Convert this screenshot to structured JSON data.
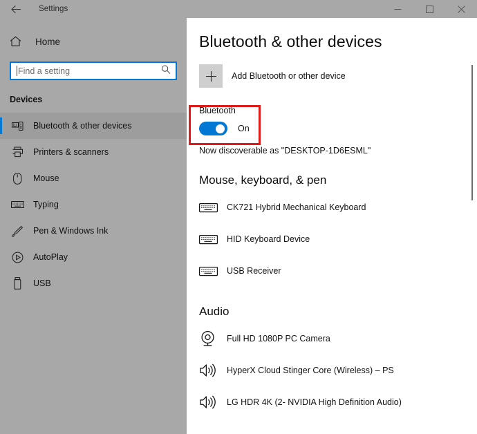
{
  "titlebar": {
    "back_icon": "back-arrow-icon",
    "title": "Settings",
    "minimize_label": "—",
    "maximize_label": "□",
    "close_label": "✕"
  },
  "sidebar": {
    "home_label": "Home",
    "home_icon": "home-icon",
    "search": {
      "placeholder": "Find a setting",
      "value": "",
      "icon": "search-icon"
    },
    "section_label": "Devices",
    "items": [
      {
        "label": "Bluetooth & other devices",
        "icon": "bluetooth-devices-icon",
        "selected": true
      },
      {
        "label": "Printers & scanners",
        "icon": "printer-icon",
        "selected": false
      },
      {
        "label": "Mouse",
        "icon": "mouse-icon",
        "selected": false
      },
      {
        "label": "Typing",
        "icon": "keyboard-icon",
        "selected": false
      },
      {
        "label": "Pen & Windows Ink",
        "icon": "pen-icon",
        "selected": false
      },
      {
        "label": "AutoPlay",
        "icon": "autoplay-icon",
        "selected": false
      },
      {
        "label": "USB",
        "icon": "usb-icon",
        "selected": false
      }
    ]
  },
  "main": {
    "page_title": "Bluetooth & other devices",
    "add_device": {
      "label": "Add Bluetooth or other device",
      "icon": "plus-icon"
    },
    "bluetooth": {
      "label": "Bluetooth",
      "state": "On",
      "toggle_on": true,
      "discoverable_text": "Now discoverable as \"DESKTOP-1D6ESML\""
    },
    "groups": [
      {
        "heading": "Mouse, keyboard, & pen",
        "devices": [
          {
            "label": "CK721 Hybrid Mechanical Keyboard",
            "icon": "keyboard-icon"
          },
          {
            "label": "HID Keyboard Device",
            "icon": "keyboard-icon"
          },
          {
            "label": "USB Receiver",
            "icon": "keyboard-icon"
          }
        ]
      },
      {
        "heading": "Audio",
        "devices": [
          {
            "label": "Full HD 1080P PC Camera",
            "icon": "camera-icon"
          },
          {
            "label": "HyperX Cloud Stinger Core (Wireless) – PS",
            "icon": "speaker-icon"
          },
          {
            "label": "LG HDR 4K (2- NVIDIA High Definition Audio)",
            "icon": "speaker-icon"
          }
        ]
      }
    ]
  },
  "colors": {
    "accent": "#0078d4",
    "highlight": "#e01919",
    "sidebar_bg": "#a8a8a8",
    "panel_bg": "#ffffff"
  }
}
